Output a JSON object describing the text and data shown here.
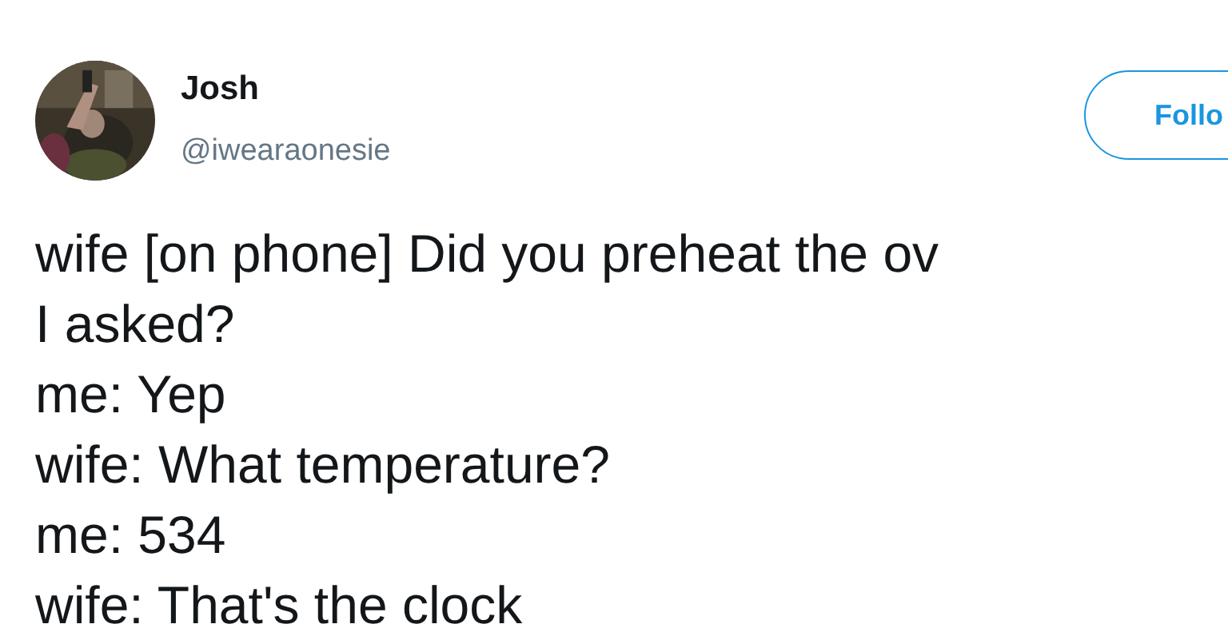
{
  "author": {
    "name": "Josh",
    "handle": "@iwearaonesie"
  },
  "follow_button": {
    "label": "Follo"
  },
  "tweet_lines": [
    "wife [on phone] Did you preheat the ov",
    "I asked?",
    "me: Yep",
    "wife: What temperature?",
    "me: 534",
    "wife: That's the clock"
  ]
}
